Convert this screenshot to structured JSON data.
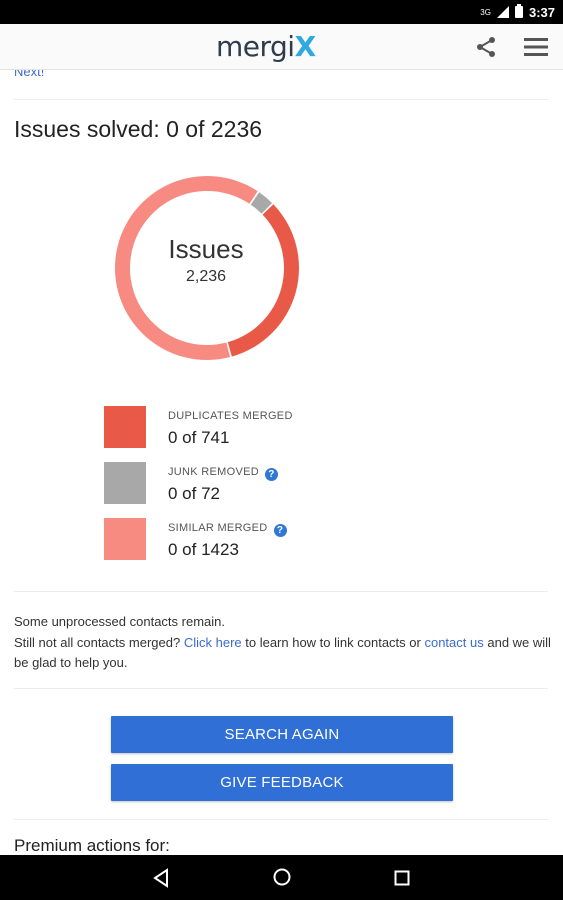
{
  "status_bar": {
    "network": "3G",
    "time": "3:37"
  },
  "app_bar": {
    "logo_text": "mergi",
    "logo_accent": "X",
    "share_icon": "share-icon",
    "menu_icon": "hamburger-menu-icon"
  },
  "next_link": "Next!",
  "summary": {
    "title": "Issues solved: 0 of 2236"
  },
  "chart_data": {
    "type": "donut",
    "center_label": "Issues",
    "center_value": "2,236",
    "total": 2236,
    "slices": [
      {
        "name": "DUPLICATES MERGED",
        "value": 741,
        "color": "#e85a47"
      },
      {
        "name": "JUNK REMOVED",
        "value": 72,
        "color": "#a8a8a8"
      },
      {
        "name": "SIMILAR MERGED",
        "value": 1423,
        "color": "#f78b82"
      }
    ]
  },
  "legend": [
    {
      "label": "DUPLICATES MERGED",
      "value": "0 of 741",
      "color": "#e85a47",
      "help": false
    },
    {
      "label": "JUNK REMOVED",
      "value": "0 of 72",
      "color": "#a8a8a8",
      "help": true
    },
    {
      "label": "SIMILAR MERGED",
      "value": "0 of 1423",
      "color": "#f78b82",
      "help": true
    }
  ],
  "info": {
    "line1": "Some unprocessed contacts remain.",
    "line2_prefix": "Still not all contacts merged?",
    "click_here": "Click here",
    "line2_middle": "to learn how to link contacts or",
    "contact_us": "contact us",
    "line2_suffix": "and we will be glad to help you."
  },
  "buttons": {
    "search_again": "SEARCH AGAIN",
    "give_feedback": "GIVE FEEDBACK"
  },
  "premium": {
    "title": "Premium actions for:"
  },
  "help_glyph": "?",
  "colors": {
    "accent": "#2f6fd6",
    "link": "#3a6ccf",
    "logo_x": "#2fa9e0"
  }
}
